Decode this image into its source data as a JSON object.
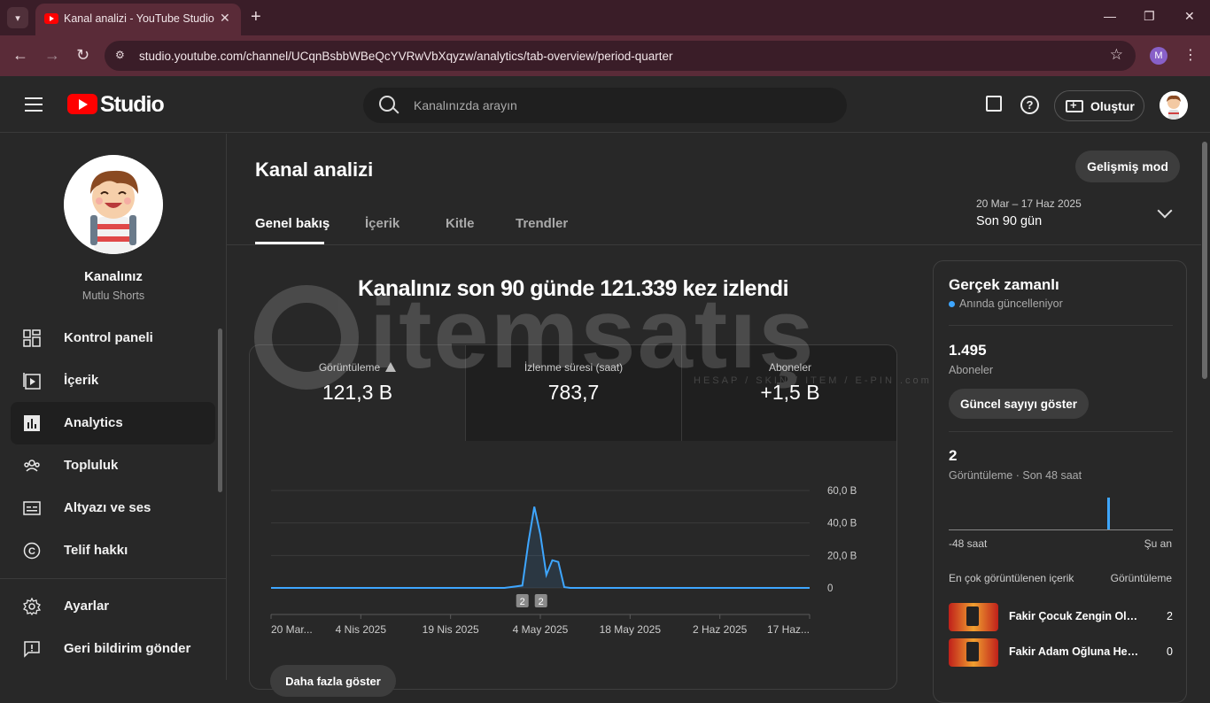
{
  "browser": {
    "tab_title": "Kanal analizi - YouTube Studio",
    "url": "studio.youtube.com/channel/UCqnBsbbWBeQcYVRwVbXqyzw/analytics/tab-overview/period-quarter",
    "profile_initial": "M"
  },
  "header": {
    "logo_text": "Studio",
    "search_placeholder": "Kanalınızda arayın",
    "create_label": "Oluştur"
  },
  "sidebar": {
    "channel_name": "Kanalınız",
    "channel_handle": "Mutlu Shorts",
    "items": [
      {
        "label": "Kontrol paneli",
        "icon": "dashboard-icon"
      },
      {
        "label": "İçerik",
        "icon": "content-icon"
      },
      {
        "label": "Analytics",
        "icon": "analytics-icon"
      },
      {
        "label": "Topluluk",
        "icon": "community-icon"
      },
      {
        "label": "Altyazı ve ses",
        "icon": "subtitles-icon"
      },
      {
        "label": "Telif hakkı",
        "icon": "copyright-icon"
      }
    ],
    "bottom_items": [
      {
        "label": "Ayarlar",
        "icon": "gear-icon"
      },
      {
        "label": "Geri bildirim gönder",
        "icon": "feedback-icon"
      }
    ]
  },
  "main": {
    "title": "Kanal analizi",
    "advanced_mode": "Gelişmiş mod",
    "tabs": [
      "Genel bakış",
      "İçerik",
      "Kitle",
      "Trendler"
    ],
    "date_range": "20 Mar – 17 Haz 2025",
    "period": "Son 90 gün",
    "headline": "Kanalınız son 90 günde 121.339 kez izlendi",
    "metrics": [
      {
        "label": "Görüntüleme",
        "value": "121,3 B"
      },
      {
        "label": "İzlenme süresi (saat)",
        "value": "783,7"
      },
      {
        "label": "Aboneler",
        "value": "+1,5 B"
      }
    ],
    "show_more": "Daha fazla göster"
  },
  "chart_data": {
    "type": "line",
    "x_labels": [
      "20 Mar...",
      "4 Nis 2025",
      "19 Nis 2025",
      "4 May 2025",
      "18 May 2025",
      "2 Haz 2025",
      "17 Haz..."
    ],
    "y_ticks": [
      "60,0 B",
      "40,0 B",
      "20,0 B",
      "0"
    ],
    "ylim": [
      0,
      60000
    ],
    "series": [
      {
        "values": [
          0,
          0,
          0,
          0,
          0,
          0,
          0,
          0,
          0,
          0,
          0,
          0,
          0,
          0,
          0,
          0,
          0,
          0,
          0,
          0,
          0,
          0,
          0,
          0,
          0,
          0,
          0,
          0,
          0,
          0,
          0,
          0,
          0,
          0,
          0,
          0,
          0,
          0,
          0,
          0,
          0,
          0,
          0,
          0,
          0,
          0,
          0,
          0,
          0,
          0,
          0,
          0,
          0,
          0,
          0,
          0,
          0,
          0,
          0,
          0,
          0,
          0,
          0,
          0,
          0,
          0,
          0,
          0,
          0,
          0,
          0,
          0,
          0,
          0,
          0,
          0,
          0,
          0,
          0,
          0,
          0,
          0,
          0,
          0,
          0,
          0,
          0,
          0,
          0,
          0,
          0
        ],
        "peaks": [
          {
            "day": 40,
            "value": 500
          },
          {
            "day": 41,
            "value": 1000
          },
          {
            "day": 42,
            "value": 1500
          },
          {
            "day": 43,
            "value": 28000
          },
          {
            "day": 44,
            "value": 50000
          },
          {
            "day": 45,
            "value": 33000
          },
          {
            "day": 46,
            "value": 8000
          },
          {
            "day": 47,
            "value": 17000
          },
          {
            "day": 48,
            "value": 16000
          },
          {
            "day": 49,
            "value": 500
          },
          {
            "day": 50,
            "value": 0
          }
        ]
      }
    ],
    "markers": [
      "2",
      "2"
    ],
    "line_color": "#3ea6ff"
  },
  "realtime": {
    "title": "Gerçek zamanlı",
    "subtitle": "Anında güncelleniyor",
    "subscribers_value": "1.495",
    "subscribers_label": "Aboneler",
    "show_count_button": "Güncel sayıyı göster",
    "views_value": "2",
    "views_label": "Görüntüleme · Son 48 saat",
    "axis_left": "-48 saat",
    "axis_right": "Şu an",
    "top_content_label": "En çok görüntülenen içerik",
    "top_content_metric": "Görüntüleme",
    "bar_chart": {
      "bars": 48,
      "active_index": 34,
      "active_value": 2
    },
    "top_content": [
      {
        "title": "Fakir Çocuk Zengin Oluyor...",
        "views": "2"
      },
      {
        "title": "Fakir Adam Oğluna Hediye...",
        "views": "0"
      }
    ]
  },
  "watermark": {
    "text": "itemsatış",
    "sub": "HESAP / SKIN / ITEM / E-PIN .com"
  }
}
